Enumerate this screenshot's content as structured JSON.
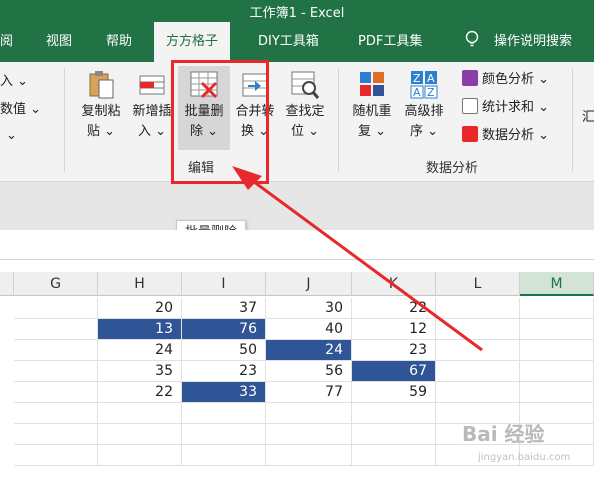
{
  "window": {
    "title": "工作簿1  -  Excel"
  },
  "tabs": [
    {
      "label": "阅",
      "active": false
    },
    {
      "label": "视图",
      "active": false
    },
    {
      "label": "帮助",
      "active": false
    },
    {
      "label": "方方格子",
      "active": true
    },
    {
      "label": "DIY工具箱",
      "active": false
    },
    {
      "label": "PDF工具集",
      "active": false
    },
    {
      "label": "操作说明搜索",
      "active": false
    }
  ],
  "ribbon": {
    "left_partial": {
      "item1": "入 ⌄",
      "item2": "数值 ⌄",
      "item3": "⌄"
    },
    "buttons": [
      {
        "line1": "复制粘",
        "line2": "贴 ⌄"
      },
      {
        "line1": "新增插",
        "line2": "入 ⌄"
      },
      {
        "line1": "批量删",
        "line2": "除 ⌄"
      },
      {
        "line1": "合并转",
        "line2": "换 ⌄"
      },
      {
        "line1": "查找定",
        "line2": "位 ⌄"
      },
      {
        "line1": "随机重",
        "line2": "复 ⌄"
      },
      {
        "line1": "高级排",
        "line2": "序 ⌄"
      }
    ],
    "small_buttons": [
      {
        "label": "颜色分析 ⌄"
      },
      {
        "label": "统计求和 ⌄"
      },
      {
        "label": "数据分析 ⌄"
      }
    ],
    "groups": {
      "edit": "编辑",
      "data_analysis": "数据分析"
    },
    "right_partial": "汇"
  },
  "tooltip": {
    "text": "批量删除"
  },
  "columns": [
    "G",
    "H",
    "I",
    "J",
    "K",
    "L",
    "M"
  ],
  "rows": [
    [
      "",
      "20",
      "37",
      "30",
      "22",
      "",
      ""
    ],
    [
      "",
      "13",
      "76",
      "40",
      "12",
      "",
      ""
    ],
    [
      "",
      "24",
      "50",
      "24",
      "23",
      "",
      ""
    ],
    [
      "",
      "35",
      "23",
      "56",
      "67",
      "",
      ""
    ],
    [
      "",
      "22",
      "33",
      "77",
      "59",
      "",
      ""
    ]
  ],
  "highlighted_cells": [
    "1-1",
    "1-2",
    "2-3",
    "3-4",
    "4-2"
  ],
  "colors": {
    "excel_green": "#217346",
    "highlight_fill": "#2f5597",
    "annotation_red": "#e8282a"
  },
  "watermark": {
    "text": "Bai 经验",
    "sub": "jingyan.baidu.com"
  }
}
